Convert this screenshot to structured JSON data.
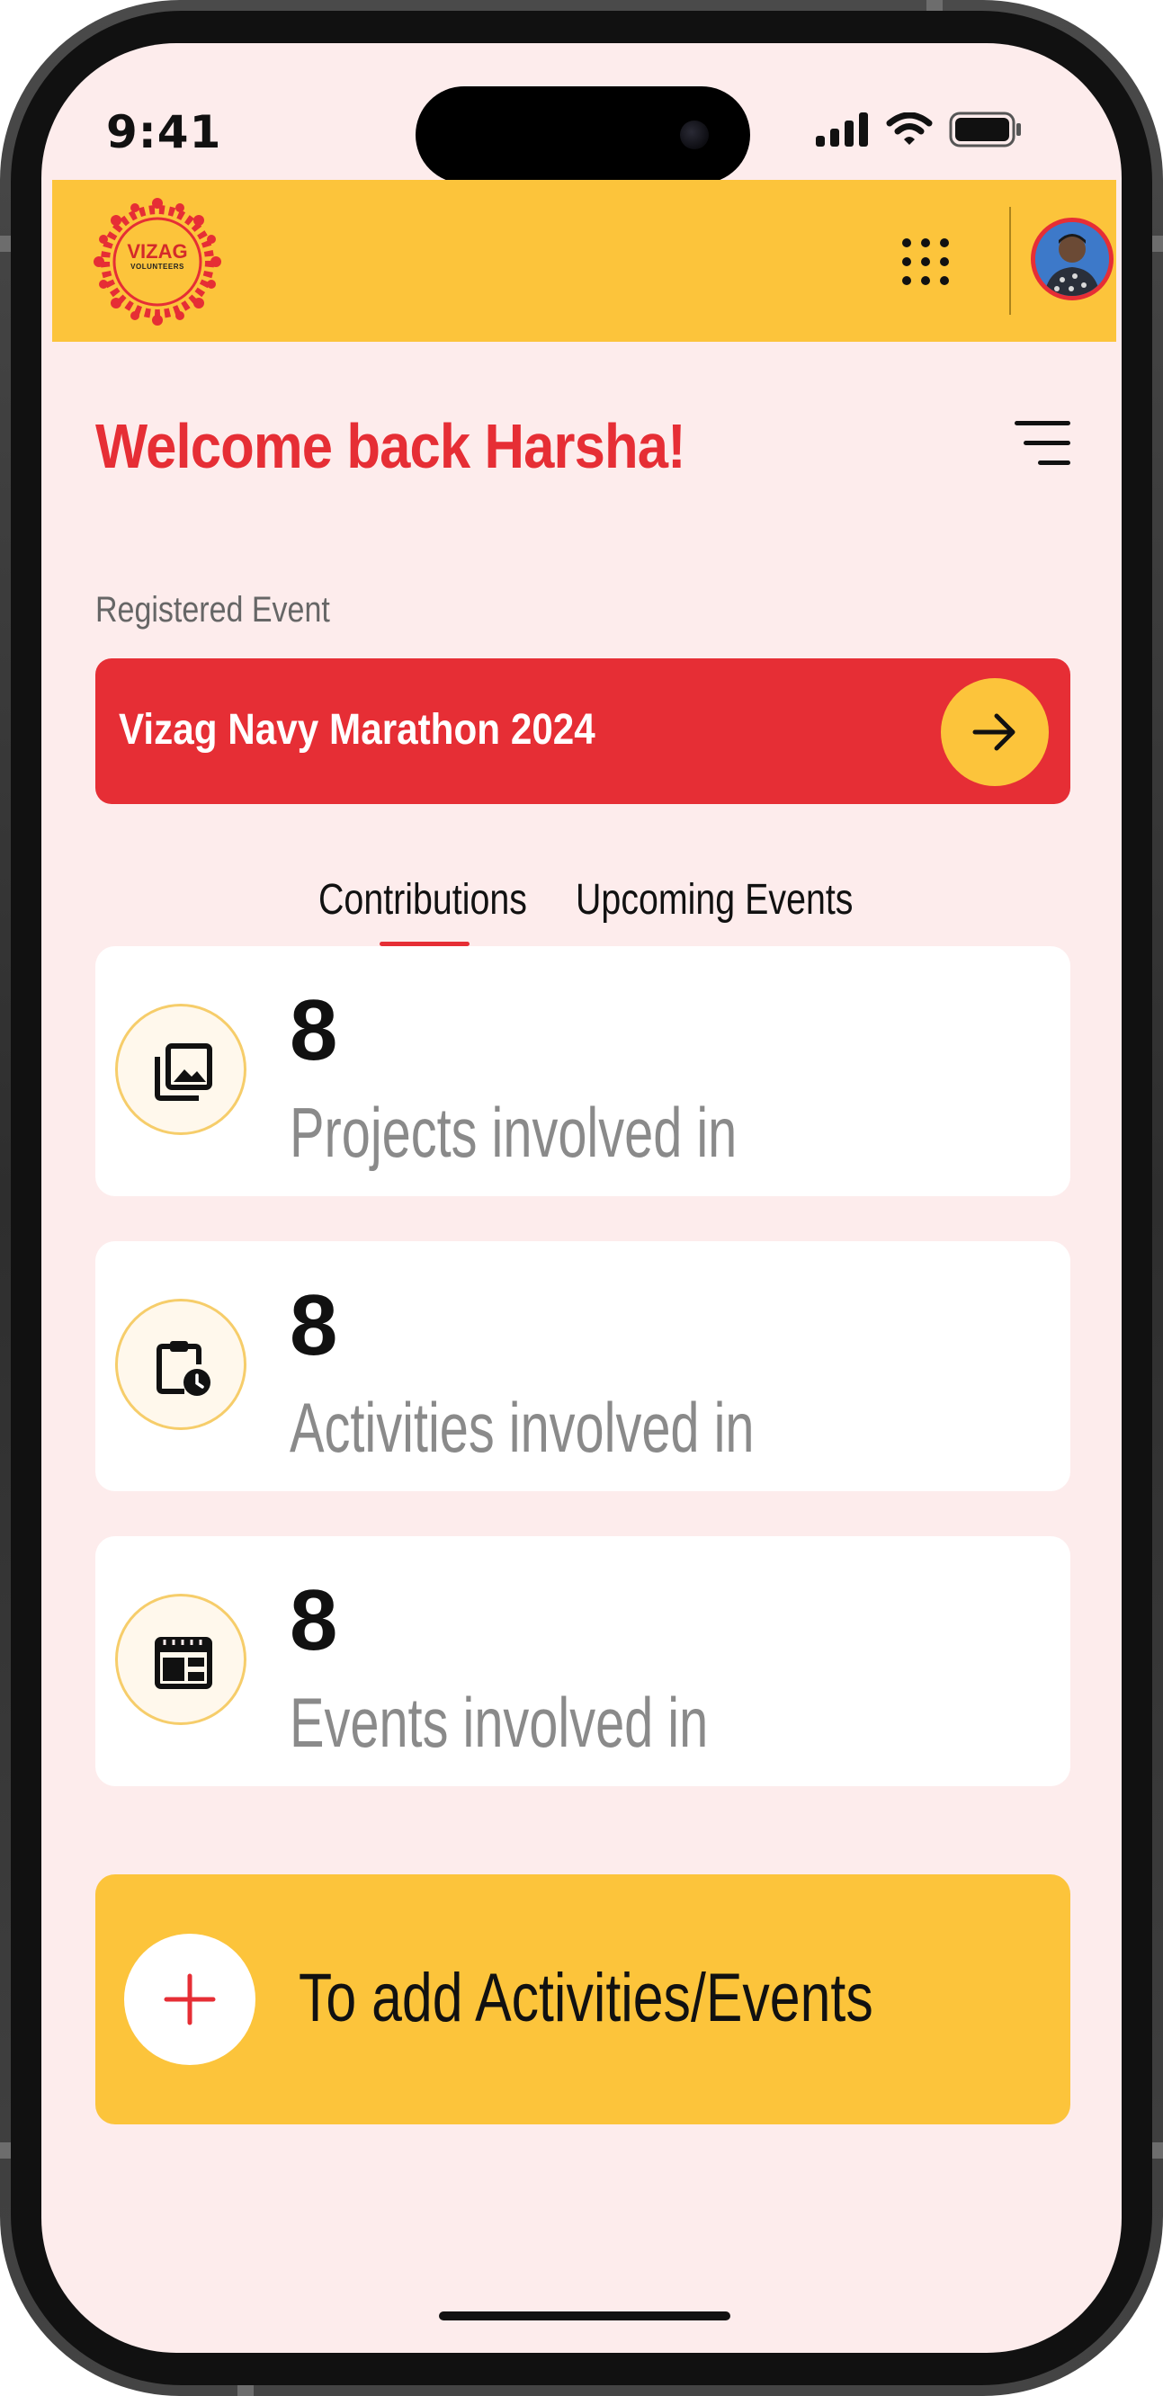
{
  "status_bar": {
    "time": "9:41"
  },
  "header": {
    "logo_text_line1": "VIZAG",
    "logo_text_line2": "VOLUNTEERS",
    "apps_icon": "grid-dots-icon",
    "avatar": "user-avatar"
  },
  "main": {
    "welcome": "Welcome back Harsha!",
    "menu_icon": "menu-lines-icon",
    "registered_label": "Registered Event",
    "registered_event": "Vizag Navy Marathon 2024",
    "tabs": [
      {
        "label": "Contributions",
        "active": true
      },
      {
        "label": "Upcoming Events",
        "active": false
      }
    ],
    "stats": [
      {
        "value": "8",
        "label": "Projects involved in",
        "icon": "gallery-icon"
      },
      {
        "value": "8",
        "label": "Activities involved in",
        "icon": "clipboard-clock-icon"
      },
      {
        "value": "8",
        "label": "Events involved in",
        "icon": "calendar-icon"
      }
    ],
    "add_label": "To add Activities/Events"
  },
  "colors": {
    "brand_yellow": "#fcc43b",
    "brand_red": "#e62e35",
    "background": "#fdecec"
  }
}
